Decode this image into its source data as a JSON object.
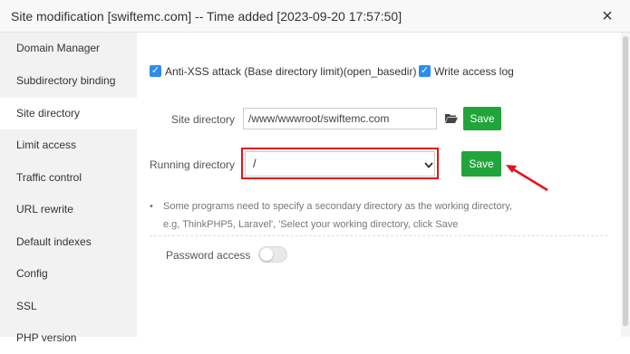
{
  "window": {
    "title": "Site modification [swiftemc.com] -- Time added [2023-09-20 17:57:50]",
    "close_icon": "×"
  },
  "sidebar": {
    "items": [
      {
        "label": "Domain Manager"
      },
      {
        "label": "Subdirectory binding"
      },
      {
        "label": "Site directory"
      },
      {
        "label": "Limit access"
      },
      {
        "label": "Traffic control"
      },
      {
        "label": "URL rewrite"
      },
      {
        "label": "Default indexes"
      },
      {
        "label": "Config"
      },
      {
        "label": "SSL"
      },
      {
        "label": "PHP version"
      }
    ],
    "active_index": 2
  },
  "options": {
    "anti_xss_label": "Anti-XSS attack (Base directory limit)(open_basedir)",
    "anti_xss_checked": true,
    "access_log_label": "Write access log",
    "access_log_checked": true
  },
  "site_directory": {
    "label": "Site directory",
    "value": "/www/wwwroot/swiftemc.com",
    "save_label": "Save"
  },
  "running_directory": {
    "label": "Running directory",
    "selected": "/",
    "save_label": "Save"
  },
  "hint": {
    "line1": "Some programs need to specify a secondary directory as the working directory,",
    "line2": "e.g, ThinkPHP5, Laravel', 'Select your working directory, click Save"
  },
  "password_access": {
    "label": "Password access",
    "enabled": false
  },
  "colors": {
    "accent_green": "#20a53a",
    "checkbox_blue": "#2d8cf0",
    "annotation_red": "#e0141e"
  }
}
